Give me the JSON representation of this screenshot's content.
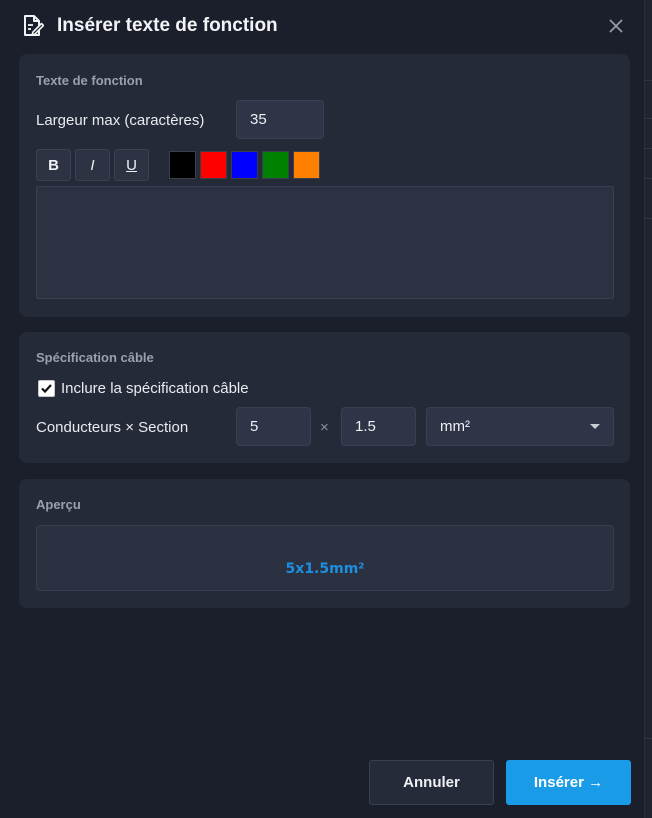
{
  "dialog": {
    "title": "Insérer texte de fonction",
    "icon": "edit-document-icon",
    "close_icon": "close-icon"
  },
  "function_text": {
    "section_title": "Texte de fonction",
    "max_width_label": "Largeur max (caractères)",
    "max_width_value": "35",
    "format_buttons": {
      "bold": "B",
      "italic": "I",
      "underline": "U"
    },
    "colors": [
      "#000000",
      "#ff0000",
      "#0000ff",
      "#008000",
      "#ff8000"
    ],
    "text_value": ""
  },
  "cable_spec": {
    "section_title": "Spécification câble",
    "include_label": "Inclure la spécification câble",
    "include_checked": true,
    "conductors_label": "Conducteurs × Section",
    "conductors_value": "5",
    "times_symbol": "×",
    "section_value": "1.5",
    "unit_selected": "mm²"
  },
  "preview": {
    "section_title": "Aperçu",
    "text": "5x1.5mm²",
    "text_color": "#1d8fe0"
  },
  "actions": {
    "cancel_label": "Annuler",
    "insert_label": "Insérer →",
    "insert_color": "#1a9be8"
  }
}
